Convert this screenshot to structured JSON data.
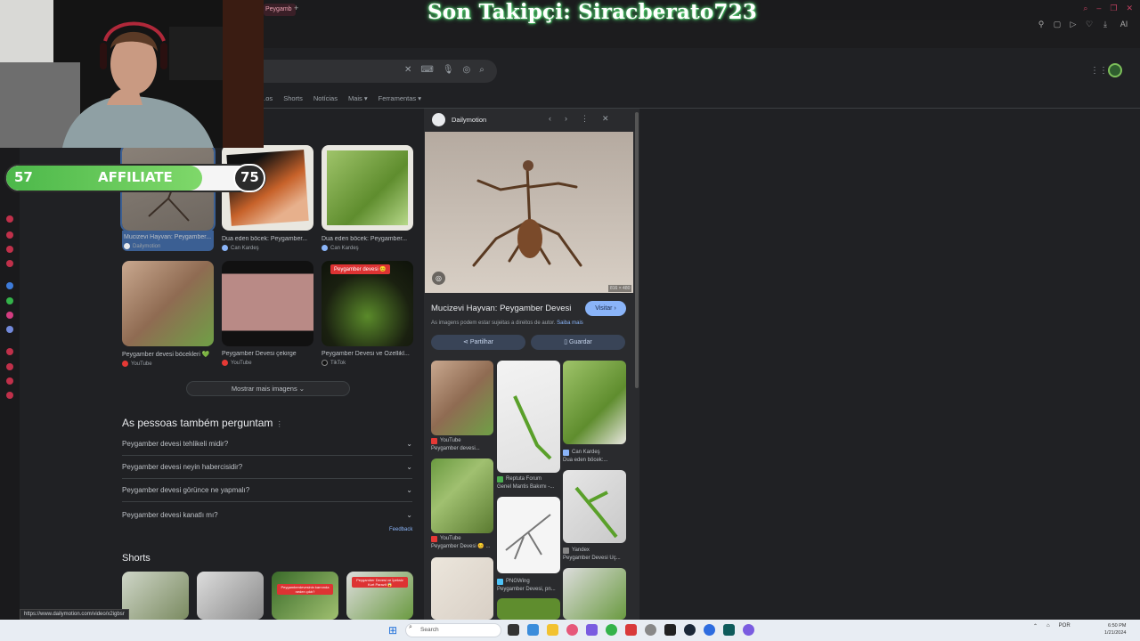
{
  "browser": {
    "tab_label": "Peygamb",
    "tab_plus": "+",
    "toolbar_ai": "AI"
  },
  "stream_overlay": {
    "last_follower": "Son Takipçi: Siracberato723",
    "goal_current": "57",
    "goal_label": "AFFILIATE",
    "goal_target": "75",
    "goal_progress": 0.76
  },
  "search": {
    "tabs": [
      "...os",
      "Shorts",
      "Notícias",
      "Mais ▾",
      "Ferramentas ▾"
    ]
  },
  "images": [
    {
      "caption": "Mucizevi Hayvan: Peygamber...",
      "source": "Dailymotion",
      "src_color": "#e8eaed"
    },
    {
      "caption": "Dua eden böcek: Peygamber...",
      "source": "Can Kardeş",
      "src_color": "#8ab4f8"
    },
    {
      "caption": "Dua eden böcek: Peygamber...",
      "source": "Can Kardeş",
      "src_color": "#8ab4f8"
    },
    {
      "caption": "Peygamber devesi böcekleri 💚",
      "source": "YouTube",
      "src_color": "#e53935"
    },
    {
      "caption": "Peygamber Devesi çekirge",
      "source": "YouTube",
      "src_color": "#e53935"
    },
    {
      "caption": "Peygamber Devesi ve Özellikl...",
      "source": "TikTok",
      "src_color": "#111"
    }
  ],
  "image_badge": "Peygamber devesi 😊",
  "more_images": "Mostrar mais imagens",
  "paa": {
    "title": "As pessoas também perguntam",
    "questions": [
      "Peygamber devesi tehlikeli midir?",
      "Peygamber devesi neyin habercisidir?",
      "Peygamber devesi görünce ne yapmalı?",
      "Peygamber devesi kanatlı mı?"
    ],
    "feedback": "Feedback"
  },
  "shorts": {
    "title": "Shorts",
    "badge_3": "Peygamberdevesinin karnında neden çıktı?",
    "badge_4": "Peygamber Devesi ve İpeksiz Kurt Parazit 😱"
  },
  "panel": {
    "site": "Dailymotion",
    "title": "Mucizevi Hayvan: Peygamber Devesi",
    "visit": "Visitar ›",
    "rights": "As imagens podem estar sujeitas a direitos de autor.",
    "learn_more": "Saiba mais",
    "share": "Partilhar",
    "save": "Guardar",
    "dims": "816 × 480",
    "related": [
      {
        "source": "YouTube",
        "title": "Peygamber devesi...",
        "src_color": "#e53935"
      },
      {
        "source": "Reptuta Forum",
        "title": "Genel Mantis Bakımı -...",
        "src_color": "#4caf50"
      },
      {
        "source": "Can Kardeş",
        "title": "Dua eden böcek:...",
        "src_color": "#8ab4f8"
      },
      {
        "source": "YouTube",
        "title": "Peygamber Devesi 😊 ...",
        "src_color": "#e53935"
      },
      {
        "source": "PNGWing",
        "title": "Peygamber Devesi, pn...",
        "src_color": "#4fc3f7"
      },
      {
        "source": "Yandex",
        "title": "Peygamber Devesi Uç...",
        "src_color": "#888"
      }
    ]
  },
  "status_url": "https://www.dailymotion.com/video/x2igbsr",
  "taskbar": {
    "search": "Search",
    "lang": "POR",
    "time": "6:50 PM",
    "date": "1/21/2024"
  }
}
